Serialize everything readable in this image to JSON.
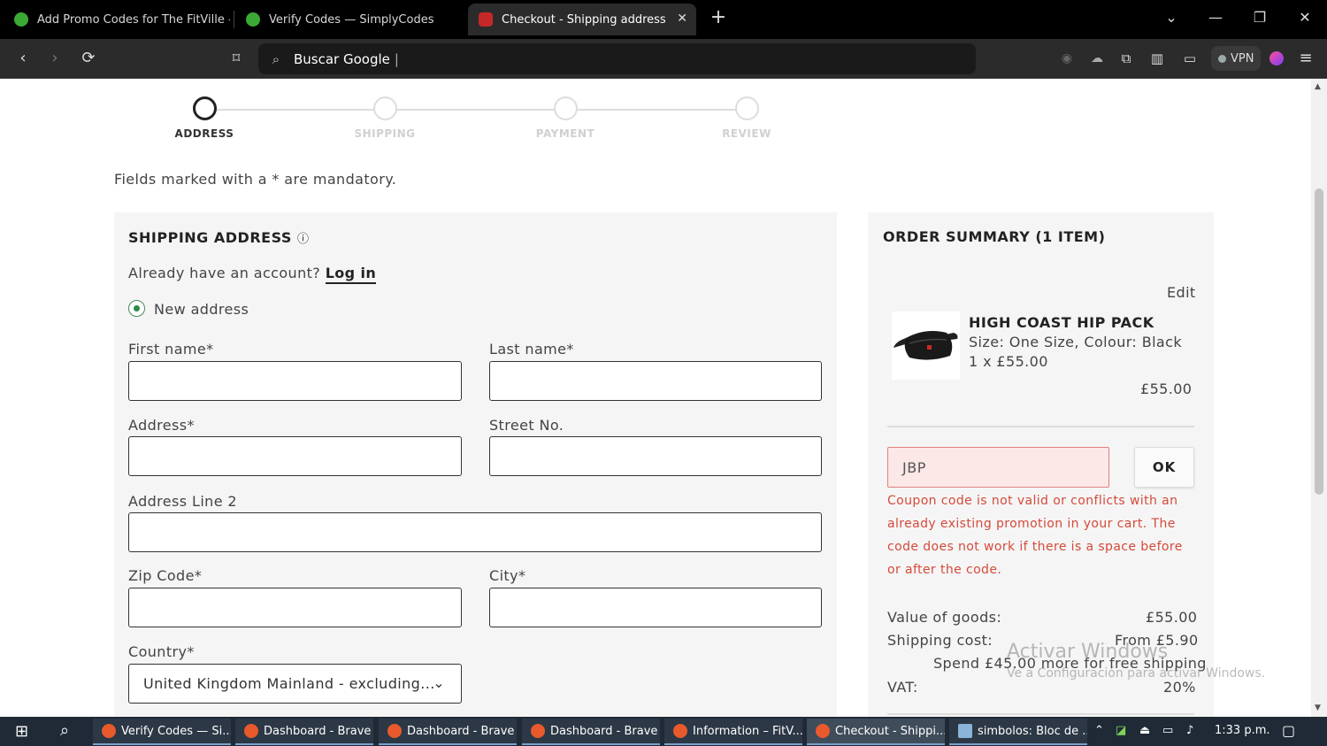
{
  "browser": {
    "tabs": [
      {
        "title": "Add Promo Codes for The FitVille —",
        "favicon_color": "#3aaa35"
      },
      {
        "title": "Verify Codes — SimplyCodes",
        "favicon_color": "#3aaa35"
      },
      {
        "title": "Checkout - Shipping address",
        "favicon_color": "#c62828",
        "active": true
      }
    ],
    "address": "Buscar Google",
    "vpn_label": "VPN"
  },
  "steps": [
    {
      "label": "ADDRESS",
      "current": true
    },
    {
      "label": "SHIPPING"
    },
    {
      "label": "PAYMENT"
    },
    {
      "label": "REVIEW"
    }
  ],
  "mandatory_note": "Fields marked with a * are mandatory.",
  "shipping": {
    "heading": "SHIPPING ADDRESS",
    "account_prompt": "Already have an account?",
    "login_link": "Log in",
    "new_address": "New address",
    "fields": {
      "first_name": "First name*",
      "last_name": "Last name*",
      "address": "Address*",
      "street_no": "Street No.",
      "address2": "Address Line 2",
      "zip": "Zip Code*",
      "city": "City*",
      "country": "Country*",
      "country_value": "United Kingdom Mainland - excluding..."
    }
  },
  "summary": {
    "heading": "ORDER SUMMARY (1 ITEM)",
    "edit": "Edit",
    "product_name": "HIGH COAST HIP PACK",
    "product_attrs": "Size:  One Size,  Colour:  Black",
    "product_qty": "1 x £55.00",
    "product_total": "£55.00",
    "coupon_value": "JBP",
    "ok_label": "OK",
    "coupon_error": "Coupon code is not valid or conflicts with an already existing promotion in your cart. The code does not work if there is a space before or after the code.",
    "value_label": "Value of goods:",
    "value_amount": "£55.00",
    "shipping_label": "Shipping cost:",
    "shipping_amount": "From £5.90",
    "free_shipping": "Spend £45.00 more for free shipping",
    "vat_label": "VAT:",
    "vat_amount": "20%"
  },
  "watermark": {
    "title": "Activar Windows",
    "sub": "Ve a Configuración para activar Windows."
  },
  "taskbar": {
    "items": [
      {
        "title": "Verify Codes — Si..."
      },
      {
        "title": "Dashboard - Brave"
      },
      {
        "title": "Dashboard - Brave"
      },
      {
        "title": "Dashboard - Brave"
      },
      {
        "title": "Information – FitV..."
      },
      {
        "title": "Checkout - Shippi...",
        "active": true
      },
      {
        "title": "simbolos: Bloc de ..."
      }
    ],
    "time": "1:33 p.m."
  }
}
